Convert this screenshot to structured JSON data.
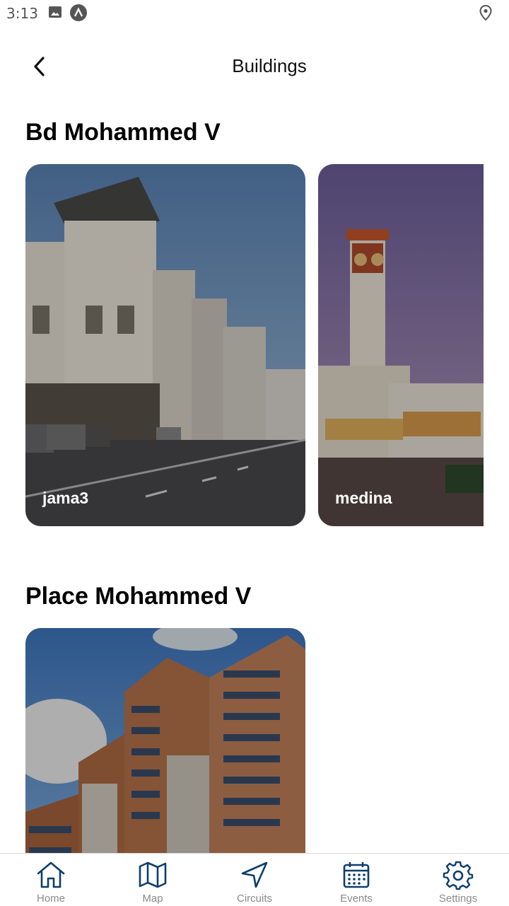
{
  "status_bar": {
    "time": "3:13"
  },
  "header": {
    "title": "Buildings"
  },
  "sections": [
    {
      "title": "Bd Mohammed V",
      "cards": [
        {
          "label": "jama3"
        },
        {
          "label": "medina"
        }
      ]
    },
    {
      "title": "Place Mohammed V",
      "cards": [
        {
          "label": ""
        }
      ]
    }
  ],
  "bottom_nav": {
    "items": [
      {
        "label": "Home",
        "icon": "home-icon"
      },
      {
        "label": "Map",
        "icon": "map-icon"
      },
      {
        "label": "Circuits",
        "icon": "navigation-icon"
      },
      {
        "label": "Events",
        "icon": "calendar-icon"
      },
      {
        "label": "Settings",
        "icon": "settings-icon"
      }
    ],
    "colors": {
      "icon": "#0d3d6e",
      "label": "#8a8a8a"
    }
  }
}
